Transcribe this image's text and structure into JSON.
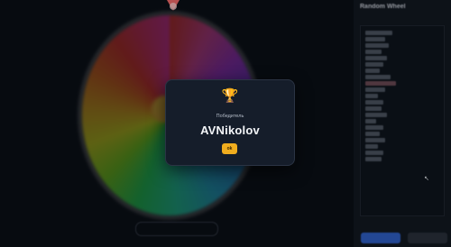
{
  "sidebar": {
    "title": "Random Wheel",
    "subtitle": "",
    "primary_button": "",
    "secondary_button": ""
  },
  "wheel": {
    "bottom_button": ""
  },
  "modal": {
    "icon": "trophy-icon",
    "label": "Победитель",
    "winner_name": "AVNikolov",
    "ok_button": "ok"
  },
  "colors": {
    "modal_bg": "#151d2a",
    "accent": "#f0ad1e",
    "pointer": "#f36b6b",
    "primary_button": "#2f5fc4"
  }
}
